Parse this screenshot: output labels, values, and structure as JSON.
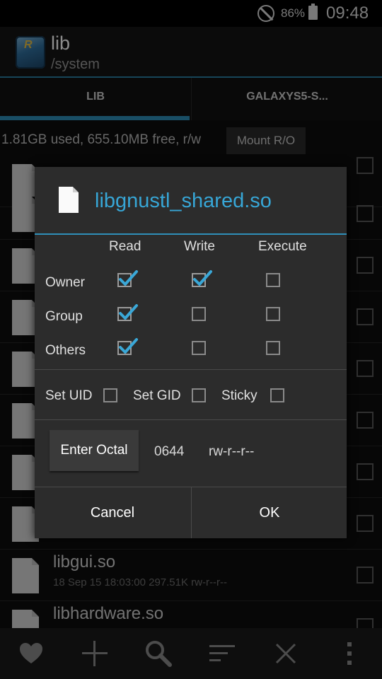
{
  "status_bar": {
    "battery": "86%",
    "time": "09:48"
  },
  "action_bar": {
    "title": "lib",
    "subtitle": "/system"
  },
  "tabs": [
    {
      "label": "LIB"
    },
    {
      "label": "GALAXYS5-S..."
    }
  ],
  "storage": {
    "text": "1.81GB used, 655.10MB free, r/w",
    "mount_button": "Mount R/O"
  },
  "files": [
    {
      "name": "libgui.so",
      "meta": "18 Sep 15 18:03:00  297.51K  rw-r--r--"
    },
    {
      "name": "libhardware.so",
      "meta": ""
    }
  ],
  "dialog": {
    "title": "libgnustl_shared.so",
    "columns": [
      "Read",
      "Write",
      "Execute"
    ],
    "rows": [
      {
        "label": "Owner",
        "read": true,
        "write": true,
        "execute": false
      },
      {
        "label": "Group",
        "read": true,
        "write": false,
        "execute": false
      },
      {
        "label": "Others",
        "read": true,
        "write": false,
        "execute": false
      }
    ],
    "special": {
      "setuid_label": "Set UID",
      "setgid_label": "Set GID",
      "sticky_label": "Sticky",
      "setuid": false,
      "setgid": false,
      "sticky": false
    },
    "octal_button": "Enter Octal",
    "octal_value": "0644",
    "permission_string": "rw-r--r--",
    "cancel_label": "Cancel",
    "ok_label": "OK"
  },
  "bottom_bar": {
    "icons": [
      "heart-icon",
      "plus-icon",
      "search-icon",
      "sort-icon",
      "close-icon",
      "overflow-menu-icon"
    ]
  },
  "colors": {
    "accent": "#2f8fb9",
    "title_blue": "#37a6d6",
    "check_blue": "#3aa8d8"
  }
}
